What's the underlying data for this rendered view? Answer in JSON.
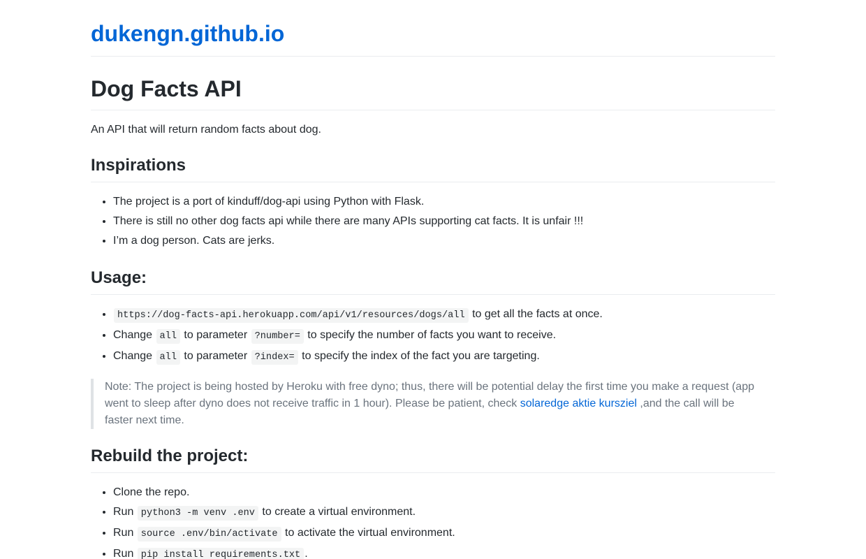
{
  "site": {
    "title": "dukengn.github.io"
  },
  "title": "Dog Facts API",
  "description": "An API that will return random facts about dog.",
  "inspirations": {
    "heading": "Inspirations",
    "items": [
      "The project is a port of kinduff/dog-api using Python with Flask.",
      "There is still no other dog facts api while there are many APIs supporting cat facts. It is unfair !!!",
      "I’m a dog person. Cats are jerks."
    ]
  },
  "usage": {
    "heading": "Usage:",
    "item1": {
      "code": "https://dog-facts-api.herokuapp.com/api/v1/resources/dogs/all",
      "text": " to get all the facts at once."
    },
    "item2": {
      "pre": "Change ",
      "code1": "all",
      "mid": " to parameter ",
      "code2": "?number=",
      "post": " to specify the number of facts you want to receive."
    },
    "item3": {
      "pre": "Change ",
      "code1": "all",
      "mid": " to parameter ",
      "code2": "?index=",
      "post": " to specify the index of the fact you are targeting."
    }
  },
  "note": {
    "text1": "Note: The project is being hosted by Heroku with free dyno; thus, there will be potential delay the first time you make a request (app went to sleep after dyno does not receive traffic in 1 hour). Please be patient, check ",
    "link": "solaredge aktie kursziel",
    "text2": " ,and the call will be faster next time."
  },
  "rebuild": {
    "heading": "Rebuild the project:",
    "item1": {
      "text": "Clone the repo."
    },
    "item2": {
      "pre": "Run ",
      "code": "python3 -m venv .env",
      "post": " to create a virtual environment."
    },
    "item3": {
      "pre": "Run ",
      "code": "source .env/bin/activate",
      "post": " to activate the virtual environment."
    },
    "item4": {
      "pre": "Run ",
      "code": "pip install requirements.txt",
      "post": "."
    }
  }
}
